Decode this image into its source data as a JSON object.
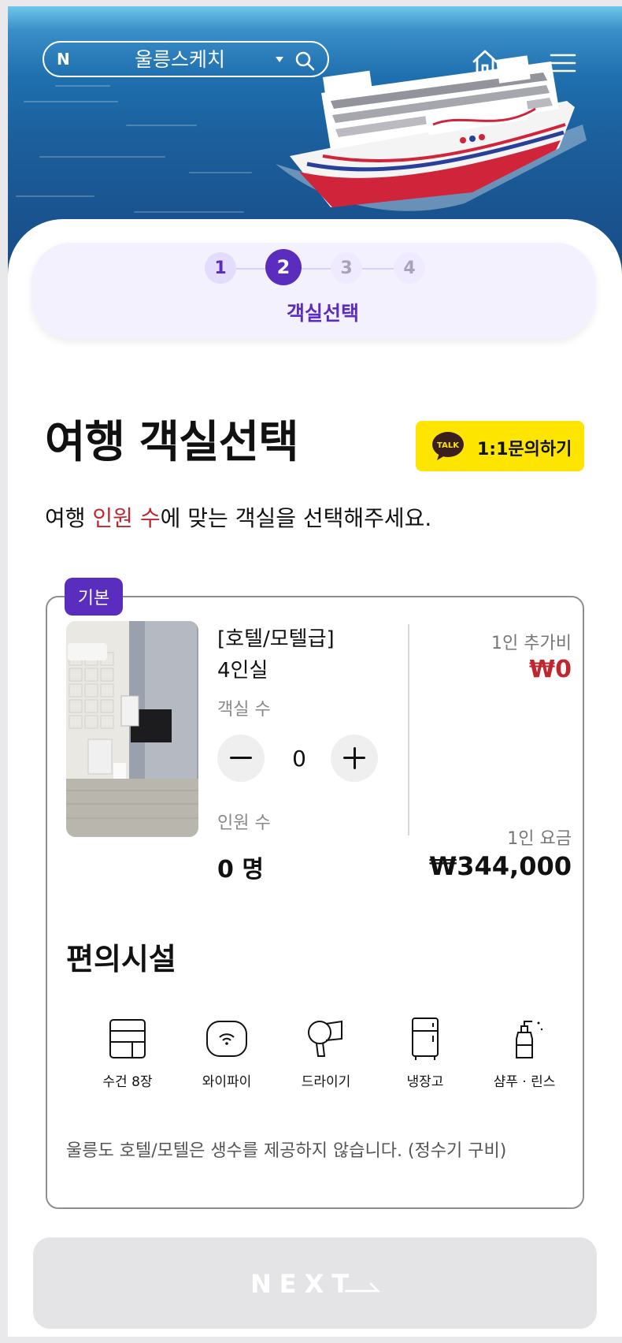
{
  "header": {
    "search_brand": "N",
    "search_text": "울릉스케치",
    "search_icon": "search-icon",
    "home_icon": "home-icon",
    "menu_icon": "hamburger-menu-icon"
  },
  "stepper": {
    "steps": [
      "1",
      "2",
      "3",
      "4"
    ],
    "active_step": 2,
    "label": "객실선택"
  },
  "page": {
    "title": "여행 객실선택",
    "talk_icon_text": "TALK",
    "talk_button": "1:1문의하기",
    "subtitle_pre": "여행 ",
    "subtitle_highlight": "인원 수",
    "subtitle_post": "에 맞는 객실을 선택해주세요."
  },
  "room": {
    "badge": "기본",
    "type": "[호텔/모텔급]",
    "capacity": "4인실",
    "rooms_label": "객실 수",
    "rooms_count": "0",
    "people_label": "인원 수",
    "people_count": "0 명",
    "extra_label": "1인 추가비",
    "extra_value": "₩0",
    "price_label": "1인 요금",
    "price_value": "₩344,000"
  },
  "amenities": {
    "title": "편의시설",
    "items": [
      {
        "label": "수건 8장",
        "icon": "towel-icon"
      },
      {
        "label": "와이파이",
        "icon": "wifi-icon"
      },
      {
        "label": "드라이기",
        "icon": "hair-dryer-icon"
      },
      {
        "label": "냉장고",
        "icon": "refrigerator-icon"
      },
      {
        "label": "샴푸 · 린스",
        "icon": "shampoo-icon"
      }
    ],
    "notice": "울릉도 호텔/모텔은 생수를 제공하지 않습니다. (정수기 구비)"
  },
  "footer": {
    "next_label": "NEXT"
  },
  "colors": {
    "accent": "#5b2dbf",
    "highlight": "#c0262d",
    "kakao": "#fee500"
  }
}
